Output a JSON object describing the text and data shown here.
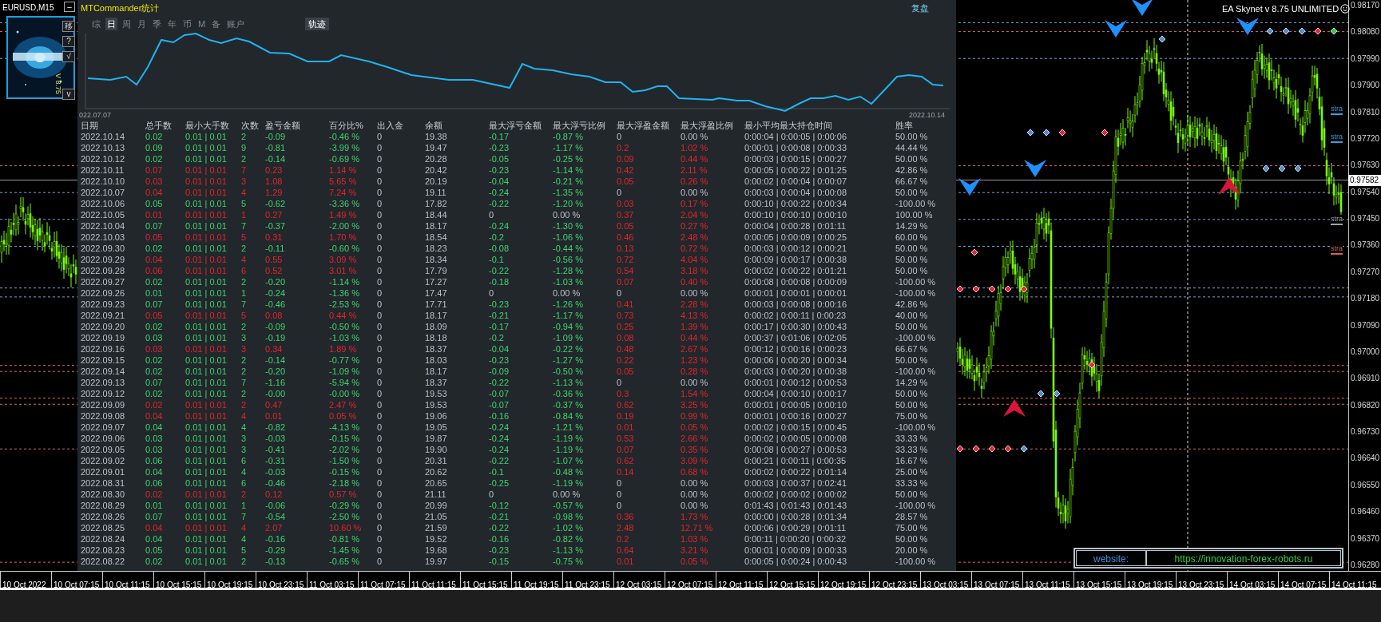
{
  "chart_window": {
    "symbol": "EURUSD,M15",
    "ea_label": "EA Skynet v 8.75 UNLIMITED",
    "side_buttons": [
      "移",
      "?",
      "√",
      "v"
    ],
    "version_text": "V 8.75",
    "minimize": "−",
    "price_axis": [
      "0.98170",
      "0.98080",
      "0.97990",
      "0.97900",
      "0.97810",
      "0.97720",
      "0.97630",
      "0.97540",
      "0.97450",
      "0.97360",
      "0.97270",
      "0.97180",
      "0.97090",
      "0.97000",
      "0.96910",
      "0.96820",
      "0.96730",
      "0.96640",
      "0.96550",
      "0.96460",
      "0.96370",
      "0.96280"
    ],
    "current_price": "0.97582",
    "strategy_tags": [
      {
        "text": "stra",
        "color": "#3b9ddd"
      },
      {
        "text": "stra",
        "color": "#3b9ddd"
      },
      {
        "text": "stra",
        "color": "#9aa4ae"
      },
      {
        "text": "stra",
        "color": "#d06060"
      }
    ],
    "website": {
      "label": "website:",
      "url": "https://innovation-forex-robots.ru"
    },
    "time_axis": [
      "10 Oct 2022",
      "10 Oct 07:15",
      "10 Oct 11:15",
      "10 Oct 15:15",
      "10 Oct 19:15",
      "10 Oct 23:15",
      "11 Oct 03:15",
      "11 Oct 07:15",
      "11 Oct 11:15",
      "11 Oct 15:15",
      "11 Oct 19:15",
      "11 Oct 23:15",
      "12 Oct 03:15",
      "12 Oct 07:15",
      "12 Oct 11:15",
      "12 Oct 15:15",
      "12 Oct 19:15",
      "12 Oct 23:15",
      "13 Oct 03:15",
      "13 Oct 07:15",
      "13 Oct 11:15",
      "13 Oct 15:15",
      "13 Oct 19:15",
      "13 Oct 23:15",
      "14 Oct 03:15",
      "14 Oct 07:15",
      "14 Oct 11:15"
    ]
  },
  "panel": {
    "title": "MTCommander统计",
    "replay_button": "复盘",
    "tabs": [
      {
        "label": "综",
        "selected": false
      },
      {
        "label": "日",
        "selected": true
      },
      {
        "label": "周",
        "selected": false
      },
      {
        "label": "月",
        "selected": false
      },
      {
        "label": "季",
        "selected": false
      },
      {
        "label": "年",
        "selected": false
      },
      {
        "label": "币",
        "selected": false
      },
      {
        "label": "M",
        "selected": false
      },
      {
        "label": "备",
        "selected": false
      },
      {
        "label": "账户",
        "selected": false
      }
    ],
    "track_button": {
      "label": "轨迹",
      "on": true
    },
    "equity_chart": {
      "start_label": "022.07.07",
      "end_label": "2022.10.14"
    },
    "table": {
      "columns": [
        "日期",
        "总手数",
        "最小大手数",
        "次数",
        "盈亏金额",
        "百分比%",
        "出入金",
        "余额",
        "最大浮亏金额",
        "最大浮亏比例",
        "最大浮盈金额",
        "最大浮盈比例",
        "最小平均最大持仓时间",
        "胜率"
      ],
      "rows": [
        {
          "cells": [
            "2022.10.14",
            "0.02",
            "0.01 | 0.01",
            "2",
            "-0.09",
            "-0.46 %",
            "0",
            "19.38",
            "-0.17",
            "-0.87 %",
            "0",
            "0.00 %",
            "0:00:04 | 0:00:05 | 0:00:06",
            "50.00 %"
          ],
          "profit": false,
          "drawdown": true,
          "runup": false
        },
        {
          "cells": [
            "2022.10.13",
            "0.09",
            "0.01 | 0.01",
            "9",
            "-0.81",
            "-3.99 %",
            "0",
            "19.47",
            "-0.23",
            "-1.17 %",
            "0.2",
            "1.02 %",
            "0:00:01 | 0:00:08 | 0:00:33",
            "44.44 %"
          ],
          "profit": false,
          "drawdown": true,
          "runup": true
        },
        {
          "cells": [
            "2022.10.12",
            "0.02",
            "0.01 | 0.01",
            "2",
            "-0.14",
            "-0.69 %",
            "0",
            "20.28",
            "-0.05",
            "-0.25 %",
            "0.09",
            "0.44 %",
            "0:00:03 | 0:00:15 | 0:00:27",
            "50.00 %"
          ],
          "profit": false,
          "drawdown": true,
          "runup": true
        },
        {
          "cells": [
            "2022.10.11",
            "0.07",
            "0.01 | 0.01",
            "7",
            "0.23",
            "1.14 %",
            "0",
            "20.42",
            "-0.23",
            "-1.14 %",
            "0.42",
            "2.11 %",
            "0:00:05 | 0:00:22 | 0:01:25",
            "42.86 %"
          ],
          "profit": true,
          "drawdown": true,
          "runup": true
        },
        {
          "cells": [
            "2022.10.10",
            "0.03",
            "0.01 | 0.01",
            "3",
            "1.08",
            "5.65 %",
            "0",
            "20.19",
            "-0.04",
            "-0.21 %",
            "0.05",
            "0.26 %",
            "0:00:02 | 0:00:04 | 0:00:07",
            "66.67 %"
          ],
          "profit": true,
          "drawdown": true,
          "runup": true
        },
        {
          "cells": [
            "2022.10.07",
            "0.04",
            "0.01 | 0.01",
            "4",
            "1.29",
            "7.24 %",
            "0",
            "19.11",
            "-0.24",
            "-1.35 %",
            "0",
            "0.00 %",
            "0:00:03 | 0:00:04 | 0:00:08",
            "50.00 %"
          ],
          "profit": true,
          "drawdown": true,
          "runup": false
        },
        {
          "cells": [
            "2022.10.06",
            "0.05",
            "0.01 | 0.01",
            "5",
            "-0.62",
            "-3.36 %",
            "0",
            "17.82",
            "-0.22",
            "-1.20 %",
            "0.03",
            "0.17 %",
            "0:00:10 | 0:00:22 | 0:00:34",
            "-100.00 %"
          ],
          "profit": false,
          "drawdown": true,
          "runup": true
        },
        {
          "cells": [
            "2022.10.05",
            "0.01",
            "0.01 | 0.01",
            "1",
            "0.27",
            "1.49 %",
            "0",
            "18.44",
            "0",
            "0.00 %",
            "0.37",
            "2.04 %",
            "0:00:10 | 0:00:10 | 0:00:10",
            "100.00 %"
          ],
          "profit": true,
          "drawdown": false,
          "runup": true
        },
        {
          "cells": [
            "2022.10.04",
            "0.07",
            "0.01 | 0.01",
            "7",
            "-0.37",
            "-2.00 %",
            "0",
            "18.17",
            "-0.24",
            "-1.30 %",
            "0.05",
            "0.27 %",
            "0:00:04 | 0:00:28 | 0:01:11",
            "14.29 %"
          ],
          "profit": false,
          "drawdown": true,
          "runup": true
        },
        {
          "cells": [
            "2022.10.03",
            "0.05",
            "0.01 | 0.01",
            "5",
            "0.31",
            "1.70 %",
            "0",
            "18.54",
            "-0.2",
            "-1.06 %",
            "0.46",
            "2.48 %",
            "0:00:05 | 0:00:09 | 0:00:25",
            "60.00 %"
          ],
          "profit": true,
          "drawdown": true,
          "runup": true
        },
        {
          "cells": [
            "2022.09.30",
            "0.02",
            "0.01 | 0.01",
            "2",
            "-0.11",
            "-0.60 %",
            "0",
            "18.23",
            "-0.08",
            "-0.44 %",
            "0.13",
            "0.72 %",
            "0:00:03 | 0:00:12 | 0:00:21",
            "50.00 %"
          ],
          "profit": false,
          "drawdown": true,
          "runup": true
        },
        {
          "cells": [
            "2022.09.29",
            "0.04",
            "0.01 | 0.01",
            "4",
            "0.55",
            "3.09 %",
            "0",
            "18.34",
            "-0.1",
            "-0.56 %",
            "0.72",
            "4.04 %",
            "0:00:09 | 0:00:17 | 0:00:38",
            "50.00 %"
          ],
          "profit": true,
          "drawdown": true,
          "runup": true
        },
        {
          "cells": [
            "2022.09.28",
            "0.06",
            "0.01 | 0.01",
            "6",
            "0.52",
            "3.01 %",
            "0",
            "17.79",
            "-0.22",
            "-1.28 %",
            "0.54",
            "3.18 %",
            "0:00:02 | 0:00:22 | 0:01:21",
            "50.00 %"
          ],
          "profit": true,
          "drawdown": true,
          "runup": true
        },
        {
          "cells": [
            "2022.09.27",
            "0.02",
            "0.01 | 0.01",
            "2",
            "-0.20",
            "-1.14 %",
            "0",
            "17.27",
            "-0.18",
            "-1.03 %",
            "0.07",
            "0.40 %",
            "0:00:08 | 0:00:08 | 0:00:09",
            "-100.00 %"
          ],
          "profit": false,
          "drawdown": true,
          "runup": true
        },
        {
          "cells": [
            "2022.09.26",
            "0.01",
            "0.01 | 0.01",
            "1",
            "-0.24",
            "-1.36 %",
            "0",
            "17.47",
            "0",
            "0.00 %",
            "0",
            "0.00 %",
            "0:00:01 | 0:00:01 | 0:00:01",
            "-100.00 %"
          ],
          "profit": false,
          "drawdown": false,
          "runup": false
        },
        {
          "cells": [
            "2022.09.23",
            "0.07",
            "0.01 | 0.01",
            "7",
            "-0.46",
            "-2.53 %",
            "0",
            "17.71",
            "-0.23",
            "-1.26 %",
            "0.41",
            "2.28 %",
            "0:00:03 | 0:00:08 | 0:00:16",
            "42.86 %"
          ],
          "profit": false,
          "drawdown": true,
          "runup": true
        },
        {
          "cells": [
            "2022.09.21",
            "0.05",
            "0.01 | 0.01",
            "5",
            "0.08",
            "0.44 %",
            "0",
            "18.17",
            "-0.21",
            "-1.17 %",
            "0.73",
            "4.13 %",
            "0:00:02 | 0:00:11 | 0:00:23",
            "40.00 %"
          ],
          "profit": true,
          "drawdown": true,
          "runup": true
        },
        {
          "cells": [
            "2022.09.20",
            "0.02",
            "0.01 | 0.01",
            "2",
            "-0.09",
            "-0.50 %",
            "0",
            "18.09",
            "-0.17",
            "-0.94 %",
            "0.25",
            "1.39 %",
            "0:00:17 | 0:00:30 | 0:00:43",
            "50.00 %"
          ],
          "profit": false,
          "drawdown": true,
          "runup": true
        },
        {
          "cells": [
            "2022.09.19",
            "0.03",
            "0.01 | 0.01",
            "3",
            "-0.19",
            "-1.03 %",
            "0",
            "18.18",
            "-0.2",
            "-1.09 %",
            "0.08",
            "0.44 %",
            "0:00:37 | 0:01:06 | 0:02:05",
            "-100.00 %"
          ],
          "profit": false,
          "drawdown": true,
          "runup": true
        },
        {
          "cells": [
            "2022.09.16",
            "0.03",
            "0.01 | 0.01",
            "3",
            "0.34",
            "1.89 %",
            "0",
            "18.37",
            "-0.04",
            "-0.22 %",
            "0.48",
            "2.67 %",
            "0:00:12 | 0:00:16 | 0:00:23",
            "66.67 %"
          ],
          "profit": true,
          "drawdown": true,
          "runup": true
        },
        {
          "cells": [
            "2022.09.15",
            "0.02",
            "0.01 | 0.01",
            "2",
            "-0.14",
            "-0.77 %",
            "0",
            "18.03",
            "-0.23",
            "-1.27 %",
            "0.22",
            "1.23 %",
            "0:00:06 | 0:00:20 | 0:00:34",
            "50.00 %"
          ],
          "profit": false,
          "drawdown": true,
          "runup": true
        },
        {
          "cells": [
            "2022.09.14",
            "0.02",
            "0.01 | 0.01",
            "2",
            "-0.20",
            "-1.09 %",
            "0",
            "18.17",
            "-0.09",
            "-0.50 %",
            "0.05",
            "0.28 %",
            "0:00:03 | 0:00:20 | 0:00:38",
            "-100.00 %"
          ],
          "profit": false,
          "drawdown": true,
          "runup": true
        },
        {
          "cells": [
            "2022.09.13",
            "0.07",
            "0.01 | 0.01",
            "7",
            "-1.16",
            "-5.94 %",
            "0",
            "18.37",
            "-0.22",
            "-1.13 %",
            "0",
            "0.00 %",
            "0:00:01 | 0:00:12 | 0:00:53",
            "14.29 %"
          ],
          "profit": false,
          "drawdown": true,
          "runup": false
        },
        {
          "cells": [
            "2022.09.12",
            "0.02",
            "0.01 | 0.01",
            "2",
            "-0.00",
            "-0.00 %",
            "0",
            "19.53",
            "-0.07",
            "-0.36 %",
            "0.3",
            "1.54 %",
            "0:00:04 | 0:00:10 | 0:00:17",
            "50.00 %"
          ],
          "profit": false,
          "drawdown": true,
          "runup": true
        },
        {
          "cells": [
            "2022.09.09",
            "0.02",
            "0.01 | 0.01",
            "2",
            "0.47",
            "2.47 %",
            "0",
            "19.53",
            "-0.07",
            "-0.37 %",
            "0.62",
            "3.25 %",
            "0:00:01 | 0:00:05 | 0:00:10",
            "50.00 %"
          ],
          "profit": true,
          "drawdown": true,
          "runup": true
        },
        {
          "cells": [
            "2022.09.08",
            "0.04",
            "0.01 | 0.01",
            "4",
            "0.01",
            "0.05 %",
            "0",
            "19.06",
            "-0.16",
            "-0.84 %",
            "0.19",
            "0.99 %",
            "0:00:01 | 0:00:16 | 0:00:27",
            "75.00 %"
          ],
          "profit": true,
          "drawdown": true,
          "runup": true
        },
        {
          "cells": [
            "2022.09.07",
            "0.04",
            "0.01 | 0.01",
            "4",
            "-0.82",
            "-4.13 %",
            "0",
            "19.05",
            "-0.24",
            "-1.21 %",
            "0.01",
            "0.05 %",
            "0:00:02 | 0:00:15 | 0:00:45",
            "-100.00 %"
          ],
          "profit": false,
          "drawdown": true,
          "runup": true
        },
        {
          "cells": [
            "2022.09.06",
            "0.03",
            "0.01 | 0.01",
            "3",
            "-0.03",
            "-0.15 %",
            "0",
            "19.87",
            "-0.24",
            "-1.19 %",
            "0.53",
            "2.66 %",
            "0:00:02 | 0:00:05 | 0:00:08",
            "33.33 %"
          ],
          "profit": false,
          "drawdown": true,
          "runup": true
        },
        {
          "cells": [
            "2022.09.05",
            "0.03",
            "0.01 | 0.01",
            "3",
            "-0.41",
            "-2.02 %",
            "0",
            "19.90",
            "-0.24",
            "-1.19 %",
            "0.07",
            "0.35 %",
            "0:00:08 | 0:00:27 | 0:00:53",
            "33.33 %"
          ],
          "profit": false,
          "drawdown": true,
          "runup": true
        },
        {
          "cells": [
            "2022.09.02",
            "0.06",
            "0.01 | 0.01",
            "6",
            "-0.31",
            "-1.50 %",
            "0",
            "20.31",
            "-0.22",
            "-1.07 %",
            "0.62",
            "3.09 %",
            "0:00:21 | 0:00:11 | 0:00:35",
            "16.67 %"
          ],
          "profit": false,
          "drawdown": true,
          "runup": true
        },
        {
          "cells": [
            "2022.09.01",
            "0.04",
            "0.01 | 0.01",
            "4",
            "-0.03",
            "-0.15 %",
            "0",
            "20.62",
            "-0.1",
            "-0.48 %",
            "0.14",
            "0.68 %",
            "0:00:02 | 0:00:22 | 0:01:14",
            "25.00 %"
          ],
          "profit": false,
          "drawdown": true,
          "runup": true
        },
        {
          "cells": [
            "2022.08.31",
            "0.06",
            "0.01 | 0.01",
            "6",
            "-0.46",
            "-2.18 %",
            "0",
            "20.65",
            "-0.25",
            "-1.19 %",
            "0",
            "0.00 %",
            "0:00:03 | 0:00:37 | 0:02:41",
            "33.33 %"
          ],
          "profit": false,
          "drawdown": true,
          "runup": false
        },
        {
          "cells": [
            "2022.08.30",
            "0.02",
            "0.01 | 0.01",
            "2",
            "0.12",
            "0.57 %",
            "0",
            "21.11",
            "0",
            "0.00 %",
            "0",
            "0.00 %",
            "0:00:02 | 0:00:02 | 0:00:02",
            "50.00 %"
          ],
          "profit": true,
          "drawdown": false,
          "runup": false
        },
        {
          "cells": [
            "2022.08.29",
            "0.01",
            "0.01 | 0.01",
            "1",
            "-0.06",
            "-0.29 %",
            "0",
            "20.99",
            "-0.12",
            "-0.57 %",
            "0",
            "0.00 %",
            "0:01:43 | 0:01:43 | 0:01:43",
            "-100.00 %"
          ],
          "profit": false,
          "drawdown": true,
          "runup": false
        },
        {
          "cells": [
            "2022.08.26",
            "0.07",
            "0.01 | 0.01",
            "7",
            "-0.54",
            "-2.50 %",
            "0",
            "21.05",
            "-0.21",
            "-0.98 %",
            "0.36",
            "1.73 %",
            "0:00:00 | 0:00:28 | 0:01:34",
            "28.57 %"
          ],
          "profit": false,
          "drawdown": true,
          "runup": true
        },
        {
          "cells": [
            "2022.08.25",
            "0.04",
            "0.01 | 0.01",
            "4",
            "2.07",
            "10.60 %",
            "0",
            "21.59",
            "-0.22",
            "-1.02 %",
            "2.48",
            "12.71 %",
            "0:00:06 | 0:00:29 | 0:01:11",
            "75.00 %"
          ],
          "profit": true,
          "drawdown": true,
          "runup": true
        },
        {
          "cells": [
            "2022.08.24",
            "0.04",
            "0.01 | 0.01",
            "4",
            "-0.16",
            "-0.81 %",
            "0",
            "19.52",
            "-0.16",
            "-0.82 %",
            "0.2",
            "1.03 %",
            "0:00:11 | 0:00:20 | 0:00:32",
            "50.00 %"
          ],
          "profit": false,
          "drawdown": true,
          "runup": true
        },
        {
          "cells": [
            "2022.08.23",
            "0.05",
            "0.01 | 0.01",
            "5",
            "-0.29",
            "-1.45 %",
            "0",
            "19.68",
            "-0.23",
            "-1.13 %",
            "0.64",
            "3.21 %",
            "0:00:01 | 0:00:09 | 0:00:33",
            "20.00 %"
          ],
          "profit": false,
          "drawdown": true,
          "runup": true
        },
        {
          "cells": [
            "2022.08.22",
            "0.02",
            "0.01 | 0.01",
            "2",
            "-0.13",
            "-0.65 %",
            "0",
            "19.97",
            "-0.15",
            "-0.75 %",
            "0.01",
            "0.05 %",
            "0:00:05 | 0:00:24 | 0:00:43",
            "-100.00 %"
          ],
          "profit": false,
          "drawdown": true,
          "runup": true
        }
      ]
    }
  }
}
